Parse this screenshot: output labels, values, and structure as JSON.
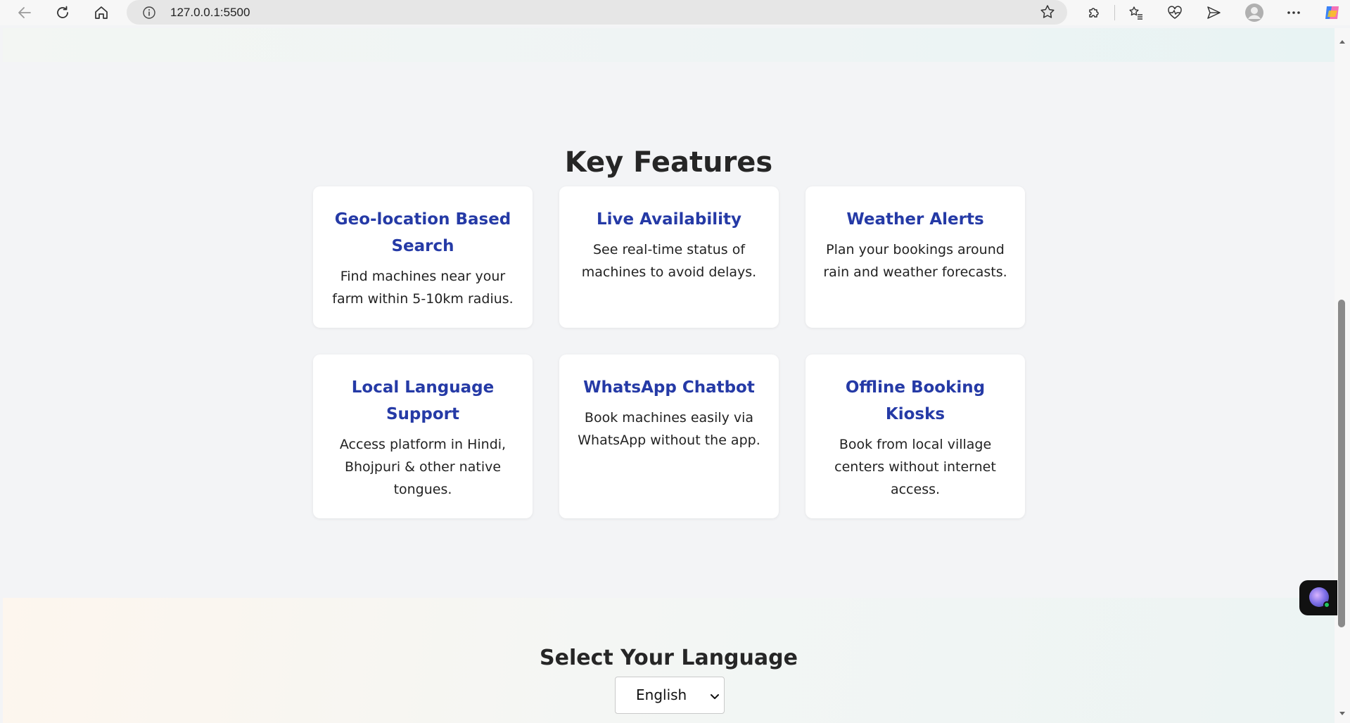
{
  "browser": {
    "url": "127.0.0.1:5500"
  },
  "features": {
    "title": "Key Features",
    "cards": [
      {
        "title": "Geo-location Based Search",
        "text": "Find machines near your farm within 5-10km radius."
      },
      {
        "title": "Live Availability",
        "text": "See real-time status of machines to avoid delays."
      },
      {
        "title": "Weather Alerts",
        "text": "Plan your bookings around rain and weather forecasts."
      },
      {
        "title": "Local Language Support",
        "text": "Access platform in Hindi, Bhojpuri & other native tongues."
      },
      {
        "title": "WhatsApp Chatbot",
        "text": "Book machines easily via WhatsApp without the app."
      },
      {
        "title": "Offline Booking Kiosks",
        "text": "Book from local village centers without internet access."
      }
    ]
  },
  "language": {
    "title": "Select Your Language",
    "selected": "English"
  },
  "colors": {
    "card_title": "#253aa6",
    "heading": "#262626",
    "page_bg": "#f3f4f6"
  }
}
